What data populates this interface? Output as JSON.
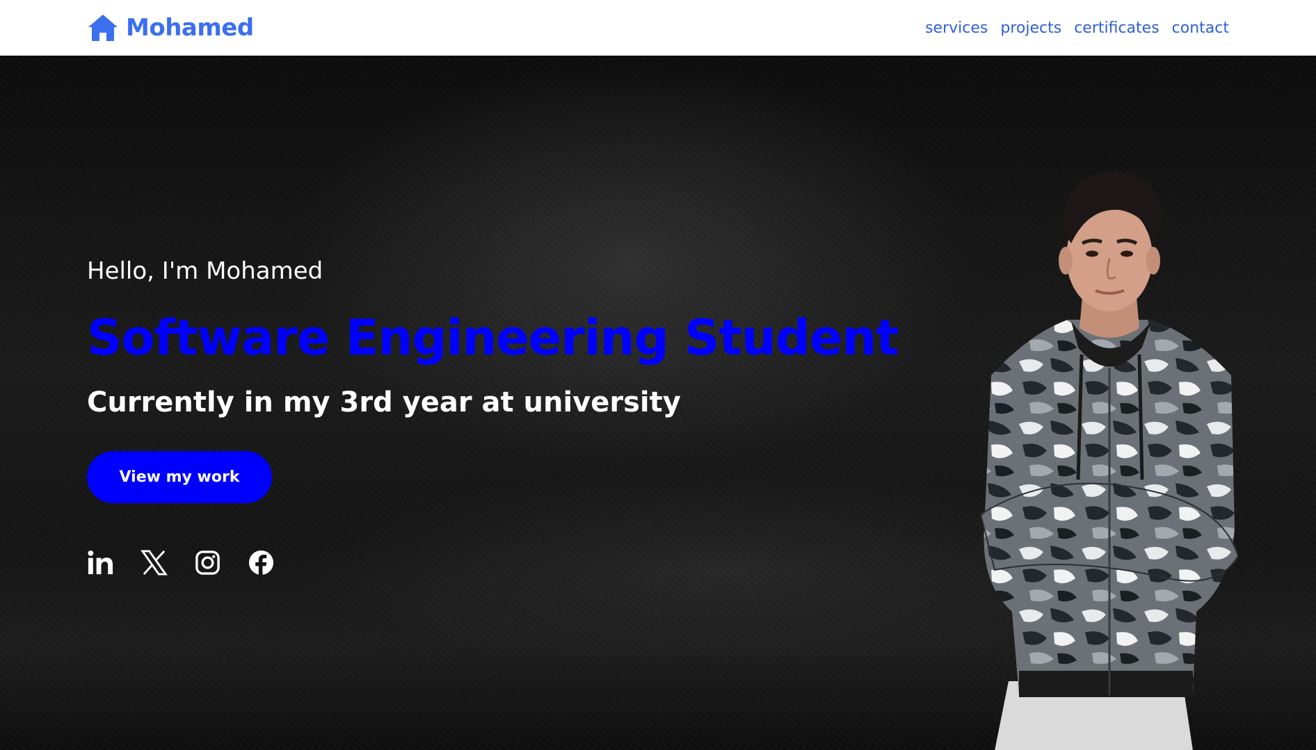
{
  "header": {
    "brand_icon": "home-icon",
    "brand_name": "Mohamed",
    "brand_color": "#3b6ff0",
    "nav": [
      {
        "label": "services"
      },
      {
        "label": "projects"
      },
      {
        "label": "certificates"
      },
      {
        "label": "contact"
      }
    ]
  },
  "hero": {
    "greeting": "Hello, I'm Mohamed",
    "role": "Software Engineering Student",
    "role_color": "#0000ff",
    "subtitle": "Currently in my 3rd year at university",
    "cta_label": "View my work",
    "socials": [
      {
        "icon": "linkedin-icon"
      },
      {
        "icon": "x-icon"
      },
      {
        "icon": "instagram-icon"
      },
      {
        "icon": "facebook-icon"
      }
    ],
    "portrait": "person-portrait"
  }
}
